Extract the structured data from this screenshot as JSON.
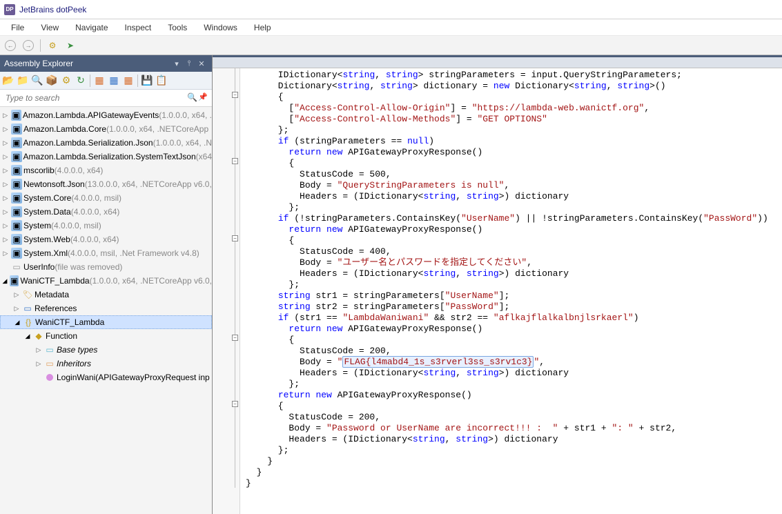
{
  "app": {
    "title": "JetBrains dotPeek",
    "icon_label": "DP"
  },
  "menu": [
    "File",
    "View",
    "Navigate",
    "Inspect",
    "Tools",
    "Windows",
    "Help"
  ],
  "panel": {
    "title": "Assembly Explorer",
    "search_placeholder": "Type to search"
  },
  "tree": [
    {
      "indent": 0,
      "arrow": "▷",
      "icon": "asm",
      "label": "Amazon.Lambda.APIGatewayEvents",
      "meta": " (1.0.0.0, x64, ."
    },
    {
      "indent": 0,
      "arrow": "▷",
      "icon": "asm",
      "label": "Amazon.Lambda.Core",
      "meta": " (1.0.0.0, x64, .NETCoreApp"
    },
    {
      "indent": 0,
      "arrow": "▷",
      "icon": "asm",
      "label": "Amazon.Lambda.Serialization.Json",
      "meta": " (1.0.0.0, x64, .N"
    },
    {
      "indent": 0,
      "arrow": "▷",
      "icon": "asm",
      "label": "Amazon.Lambda.Serialization.SystemTextJson",
      "meta": " (x64"
    },
    {
      "indent": 0,
      "arrow": "▷",
      "icon": "asm",
      "label": "mscorlib",
      "meta": " (4.0.0.0, x64)"
    },
    {
      "indent": 0,
      "arrow": "▷",
      "icon": "asm",
      "label": "Newtonsoft.Json",
      "meta": " (13.0.0.0, x64, .NETCoreApp v6.0,"
    },
    {
      "indent": 0,
      "arrow": "▷",
      "icon": "asm",
      "label": "System.Core",
      "meta": " (4.0.0.0, msil)"
    },
    {
      "indent": 0,
      "arrow": "▷",
      "icon": "asm",
      "label": "System.Data",
      "meta": " (4.0.0.0, x64)"
    },
    {
      "indent": 0,
      "arrow": "▷",
      "icon": "asm",
      "label": "System",
      "meta": " (4.0.0.0, msil)"
    },
    {
      "indent": 0,
      "arrow": "▷",
      "icon": "asm",
      "label": "System.Web",
      "meta": " (4.0.0.0, x64)"
    },
    {
      "indent": 0,
      "arrow": "▷",
      "icon": "asm",
      "label": "System.Xml",
      "meta": " (4.0.0.0, msil, .Net Framework v4.8)"
    },
    {
      "indent": 0,
      "arrow": "",
      "icon": "user",
      "label": "UserInfo",
      "meta": " (file was removed)"
    },
    {
      "indent": 0,
      "arrow": "◢",
      "icon": "asm",
      "label": "WaniCTF_Lambda",
      "meta": " (1.0.0.0, x64, .NETCoreApp v6.0,"
    },
    {
      "indent": 1,
      "arrow": "▷",
      "icon": "meta",
      "label": "Metadata",
      "meta": ""
    },
    {
      "indent": 1,
      "arrow": "▷",
      "icon": "ref",
      "label": "References",
      "meta": ""
    },
    {
      "indent": 1,
      "arrow": "◢",
      "icon": "ns",
      "label": "WaniCTF_Lambda",
      "meta": "",
      "selected": true
    },
    {
      "indent": 2,
      "arrow": "◢",
      "icon": "cls",
      "label": "Function",
      "meta": ""
    },
    {
      "indent": 3,
      "arrow": "▷",
      "icon": "base",
      "label": "Base types",
      "meta": "",
      "italic": true
    },
    {
      "indent": 3,
      "arrow": "▷",
      "icon": "inh",
      "label": "Inheritors",
      "meta": "",
      "italic": true
    },
    {
      "indent": 3,
      "arrow": "",
      "icon": "func",
      "label": "LoginWani(APIGatewayProxyRequest inp",
      "meta": ""
    }
  ],
  "code": {
    "tokens": [
      [
        [
          "      IDictionary<"
        ],
        [
          "kw",
          "string"
        ],
        [
          ", "
        ],
        [
          "kw",
          "string"
        ],
        [
          "> stringParameters = input.QueryStringParameters;"
        ]
      ],
      [
        [
          "      Dictionary<"
        ],
        [
          "kw",
          "string"
        ],
        [
          ", "
        ],
        [
          "kw",
          "string"
        ],
        [
          "> dictionary = "
        ],
        [
          "kw",
          "new"
        ],
        [
          " Dictionary<"
        ],
        [
          "kw",
          "string"
        ],
        [
          ", "
        ],
        [
          "kw",
          "string"
        ],
        [
          ">()"
        ]
      ],
      [
        [
          "      {"
        ]
      ],
      [
        [
          "        ["
        ],
        [
          "str",
          "\"Access-Control-Allow-Origin\""
        ],
        [
          "] = "
        ],
        [
          "str",
          "\"https://lambda-web.wanictf.org\""
        ],
        [
          ","
        ]
      ],
      [
        [
          "        ["
        ],
        [
          "str",
          "\"Access-Control-Allow-Methods\""
        ],
        [
          "] = "
        ],
        [
          "str",
          "\"GET OPTIONS\""
        ]
      ],
      [
        [
          "      };"
        ]
      ],
      [
        [
          "      "
        ],
        [
          "kw",
          "if"
        ],
        [
          " (stringParameters == "
        ],
        [
          "kw",
          "null"
        ],
        [
          ")"
        ]
      ],
      [
        [
          "        "
        ],
        [
          "kw",
          "return"
        ],
        [
          " "
        ],
        [
          "kw",
          "new"
        ],
        [
          " APIGatewayProxyResponse()"
        ]
      ],
      [
        [
          "        {"
        ]
      ],
      [
        [
          "          StatusCode = 500,"
        ]
      ],
      [
        [
          "          Body = "
        ],
        [
          "str",
          "\"QueryStringParameters is null\""
        ],
        [
          ","
        ]
      ],
      [
        [
          "          Headers = (IDictionary<"
        ],
        [
          "kw",
          "string"
        ],
        [
          ", "
        ],
        [
          "kw",
          "string"
        ],
        [
          ">) dictionary"
        ]
      ],
      [
        [
          "        };"
        ]
      ],
      [
        [
          "      "
        ],
        [
          "kw",
          "if"
        ],
        [
          " (!stringParameters.ContainsKey("
        ],
        [
          "str",
          "\"UserName\""
        ],
        [
          ") || !stringParameters.ContainsKey("
        ],
        [
          "str",
          "\"PassWord\""
        ],
        [
          "))"
        ]
      ],
      [
        [
          "        "
        ],
        [
          "kw",
          "return"
        ],
        [
          " "
        ],
        [
          "kw",
          "new"
        ],
        [
          " APIGatewayProxyResponse()"
        ]
      ],
      [
        [
          "        {"
        ]
      ],
      [
        [
          "          StatusCode = 400,"
        ]
      ],
      [
        [
          "          Body = "
        ],
        [
          "str",
          "\"ユーザー名とパスワードを指定してください\""
        ],
        [
          ","
        ]
      ],
      [
        [
          "          Headers = (IDictionary<"
        ],
        [
          "kw",
          "string"
        ],
        [
          ", "
        ],
        [
          "kw",
          "string"
        ],
        [
          ">) dictionary"
        ]
      ],
      [
        [
          "        };"
        ]
      ],
      [
        [
          "      "
        ],
        [
          "kw",
          "string"
        ],
        [
          " str1 = stringParameters["
        ],
        [
          "str",
          "\"UserName\""
        ],
        [
          "];"
        ]
      ],
      [
        [
          "      "
        ],
        [
          "kw",
          "string"
        ],
        [
          " str2 = stringParameters["
        ],
        [
          "str",
          "\"PassWord\""
        ],
        [
          "];"
        ]
      ],
      [
        [
          "      "
        ],
        [
          "kw",
          "if"
        ],
        [
          " (str1 == "
        ],
        [
          "str",
          "\"LambdaWaniwani\""
        ],
        [
          " && str2 == "
        ],
        [
          "str",
          "\"aflkajflalkalbnjlsrkaerl\""
        ],
        [
          ")"
        ]
      ],
      [
        [
          "        "
        ],
        [
          "kw",
          "return"
        ],
        [
          " "
        ],
        [
          "kw",
          "new"
        ],
        [
          " APIGatewayProxyResponse()"
        ]
      ],
      [
        [
          "        {"
        ]
      ],
      [
        [
          "          StatusCode = 200,"
        ]
      ],
      [
        [
          "          Body = "
        ],
        [
          "str",
          "\""
        ],
        [
          "hl",
          "FLAG{l4mabd4_1s_s3rverl3ss_s3rv1c3}"
        ],
        [
          "str",
          "\""
        ],
        [
          ","
        ]
      ],
      [
        [
          "          Headers = (IDictionary<"
        ],
        [
          "kw",
          "string"
        ],
        [
          ", "
        ],
        [
          "kw",
          "string"
        ],
        [
          ">) dictionary"
        ]
      ],
      [
        [
          "        };"
        ]
      ],
      [
        [
          "      "
        ],
        [
          "kw",
          "return"
        ],
        [
          " "
        ],
        [
          "kw",
          "new"
        ],
        [
          " APIGatewayProxyResponse()"
        ]
      ],
      [
        [
          "      {"
        ]
      ],
      [
        [
          "        StatusCode = 200,"
        ]
      ],
      [
        [
          "        Body = "
        ],
        [
          "str",
          "\"Password or UserName are incorrect!!! :  \""
        ],
        [
          " + str1 + "
        ],
        [
          "str",
          "\": \""
        ],
        [
          " + str2,"
        ]
      ],
      [
        [
          "        Headers = (IDictionary<"
        ],
        [
          "kw",
          "string"
        ],
        [
          ", "
        ],
        [
          "kw",
          "string"
        ],
        [
          ">) dictionary"
        ]
      ],
      [
        [
          "      };"
        ]
      ],
      [
        [
          "    }"
        ]
      ],
      [
        [
          "  }"
        ]
      ],
      [
        [
          "}"
        ]
      ]
    ]
  }
}
